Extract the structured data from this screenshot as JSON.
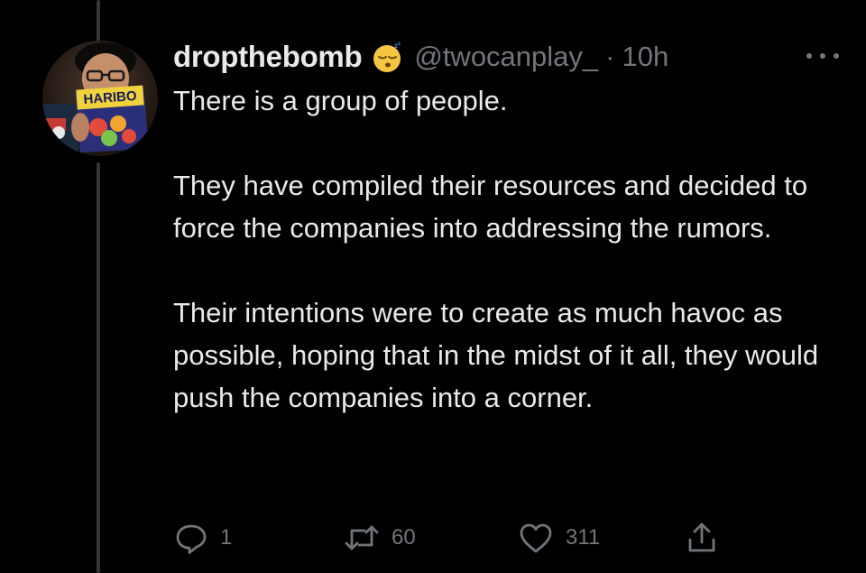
{
  "tweet": {
    "display_name": "dropthebomb",
    "handle": "@twocanplay_",
    "separator": "·",
    "time": "10h",
    "badge_emoji": "sleeping-face-emoji",
    "avatar_sign_text": "HARIBO",
    "paragraphs": [
      "There is a group of people.",
      "They have compiled their resources and decided to force the companies into addressing the rumors.",
      "Their intentions were to create as much havoc as possible, hoping that in the midst of it all, they would push the companies into a corner."
    ]
  },
  "actions": {
    "reply": {
      "icon": "reply-icon",
      "count": "1"
    },
    "retweet": {
      "icon": "retweet-icon",
      "count": "60"
    },
    "like": {
      "icon": "heart-icon",
      "count": "311"
    },
    "share": {
      "icon": "share-icon"
    }
  },
  "colors": {
    "background": "#000000",
    "text_primary": "#e7e9ea",
    "text_secondary": "#71767b",
    "thread_line": "#333639"
  }
}
